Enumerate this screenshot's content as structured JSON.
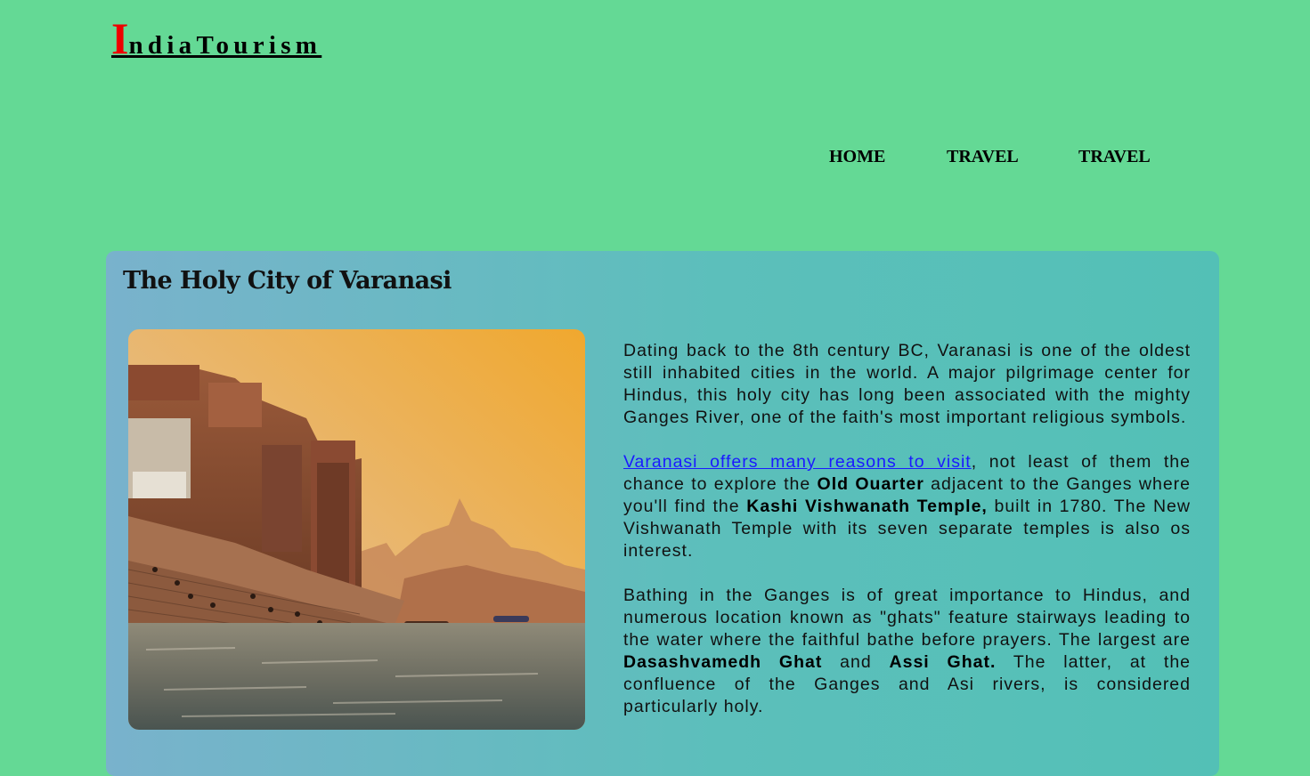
{
  "logo": {
    "first": "I",
    "rest": "ndiaTourism"
  },
  "nav": {
    "home": "HOME",
    "travel1": "TRAVEL",
    "travel2": "TRAVEL"
  },
  "article": {
    "title": "The Holy City of Varanasi",
    "p1": "Dating back to the 8th century BC, Varanasi is one of the oldest still inhabited cities in the world. A major pilgrimage center for Hindus, this holy city has long been associated with the mighty Ganges River, one of the faith's most important religious symbols.",
    "p2_link": "Varanasi offers many reasons to visit",
    "p2_a": ", not least of them the chance to explore the ",
    "p2_b1": "Old Ouarter",
    "p2_c": " adjacent to the Ganges where you'll find the ",
    "p2_b2": "Kashi Vishwanath Temple,",
    "p2_d": " built in 1780. The New Vishwanath Temple with its seven separate temples is also os interest.",
    "p3_a": "Bathing in the Ganges is of great importance to Hindus, and numerous location known as \"ghats\" feature stairways leading to the water where the faithful bathe before prayers. The largest are ",
    "p3_b1": "Dasashvamedh Ghat",
    "p3_c": " and ",
    "p3_b2": "Assi Ghat.",
    "p3_d": " The latter, at the confluence of the Ganges and Asi rivers, is considered particularly holy."
  },
  "colors": {
    "page_bg": "#64d995",
    "logo_first": "#ee0000",
    "link": "#1a1aff"
  }
}
